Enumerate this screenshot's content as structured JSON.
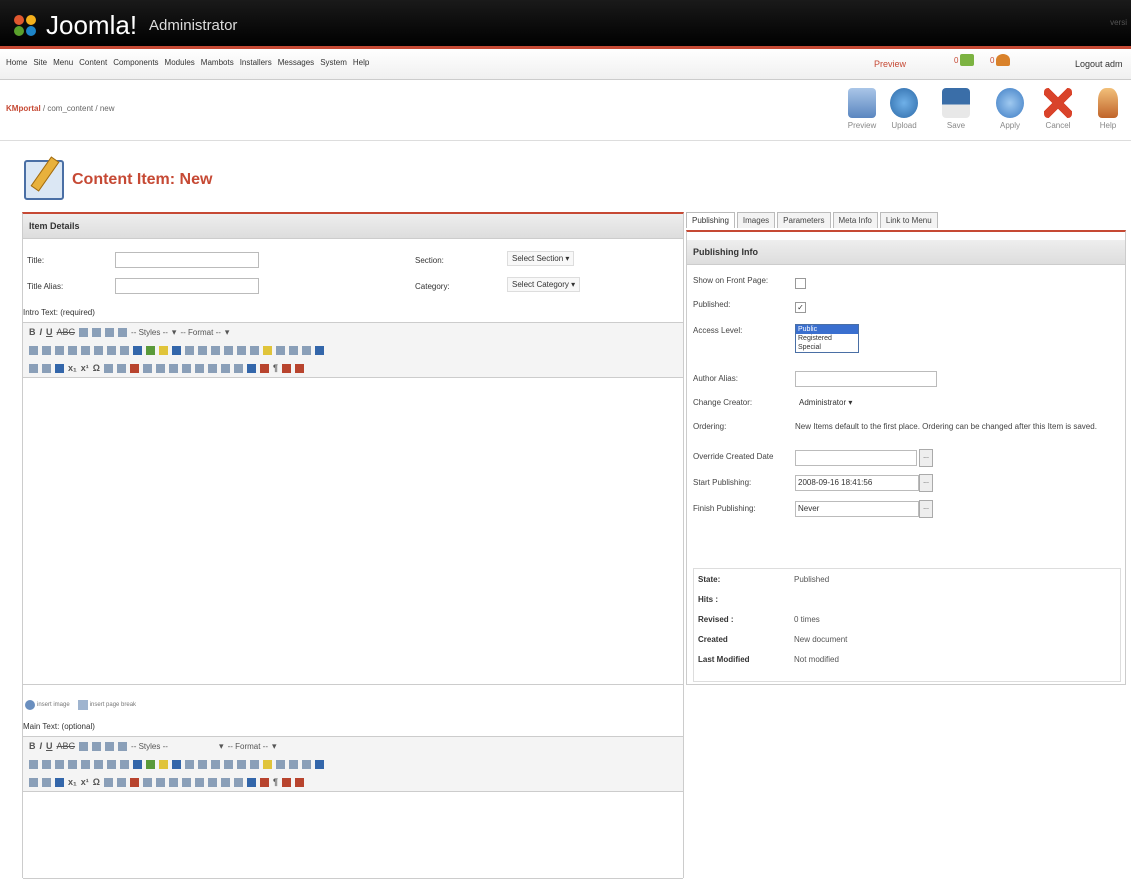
{
  "app": {
    "logo_text": "Joomla!",
    "logo_sub": "Administrator",
    "version_text": "versi"
  },
  "menu": [
    "Home",
    "Site",
    "Menu",
    "Content",
    "Components",
    "Modules",
    "Mambots",
    "Installers",
    "Messages",
    "System",
    "Help"
  ],
  "menubar": {
    "preview": "Preview",
    "messages_count": "0",
    "users_count": "0",
    "logout": "Logout adm"
  },
  "breadcrumb": {
    "site": "KMportal",
    "path": " / com_content / new"
  },
  "toolbar": [
    {
      "label": "Preview",
      "icon": "preview-icon"
    },
    {
      "label": "Upload",
      "icon": "upload-icon"
    },
    {
      "label": "Save",
      "icon": "save-icon"
    },
    {
      "label": "Apply",
      "icon": "apply-icon"
    },
    {
      "label": "Cancel",
      "icon": "cancel-icon"
    },
    {
      "label": "Help",
      "icon": "help-icon"
    }
  ],
  "page": {
    "title": "Content Item: New"
  },
  "details": {
    "header": "Item Details",
    "title_label": "Title:",
    "alias_label": "Title Alias:",
    "section_label": "Section:",
    "section_value": "Select Section",
    "category_label": "Category:",
    "category_value": "Select Category",
    "intro_label": "Intro Text: (required)",
    "main_label": "Main Text: (optional)",
    "styles": "-- Styles --",
    "format": "-- Format --",
    "insert_image": "insert image",
    "insert_pagebreak": "insert page break"
  },
  "tabs": [
    "Publishing",
    "Images",
    "Parameters",
    "Meta Info",
    "Link to Menu"
  ],
  "publishing": {
    "header": "Publishing Info",
    "front_page_label": "Show on Front Page:",
    "published_label": "Published:",
    "access_label": "Access Level:",
    "access_options": [
      "Public",
      "Registered",
      "Special"
    ],
    "author_alias_label": "Author Alias:",
    "change_creator_label": "Change Creator:",
    "creator_value": "Administrator",
    "ordering_label": "Ordering:",
    "ordering_text": "New Items default to the first place. Ordering can be changed after this Item is saved.",
    "override_label": "Override Created Date",
    "start_label": "Start Publishing:",
    "start_value": "2008-09-16 18:41:56",
    "finish_label": "Finish Publishing:",
    "finish_value": "Never",
    "dots": "..."
  },
  "state": [
    {
      "label": "State:",
      "value": "Published"
    },
    {
      "label": "Hits :",
      "value": ""
    },
    {
      "label": "Revised :",
      "value": "0 times"
    },
    {
      "label": "Created",
      "value": "New document"
    },
    {
      "label": "Last Modified",
      "value": "Not modified"
    }
  ]
}
